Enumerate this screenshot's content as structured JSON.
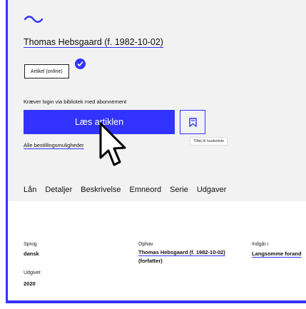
{
  "author_link": "Thomas Hebsgaard (f. 1982-10-02)",
  "material_chip": "Artikel (online)",
  "login_note": "Kræver login via bibliotek med abonnement",
  "read_button": "Læs artiklen",
  "bookmark_tooltip": "Tilføj til huskeliste",
  "all_options_link": "Alle bestillingsmuligheder",
  "tabs": [
    "Lån",
    "Detaljer",
    "Beskrivelse",
    "Emneord",
    "Serie",
    "Udgaver"
  ],
  "details": {
    "sprog": {
      "label": "Sprog",
      "value": "dansk"
    },
    "ophav": {
      "label": "Ophav",
      "value": "Thomas Hebsgaard (f. 1982-10-02)",
      "role": "(forfatter)"
    },
    "indgaar_i": {
      "label": "Indgår i",
      "value": "Langsomme forand"
    },
    "udgivet": {
      "label": "Udgivet",
      "value": "2020"
    }
  },
  "colors": {
    "accent": "#3333ff",
    "hero_bg": "#f2f2f2"
  },
  "icons": {
    "logo": "wave-logo-icon",
    "badge": "checkmark-icon",
    "bookmark": "bookmark-icon",
    "pointer": "mouse-pointer-icon"
  }
}
